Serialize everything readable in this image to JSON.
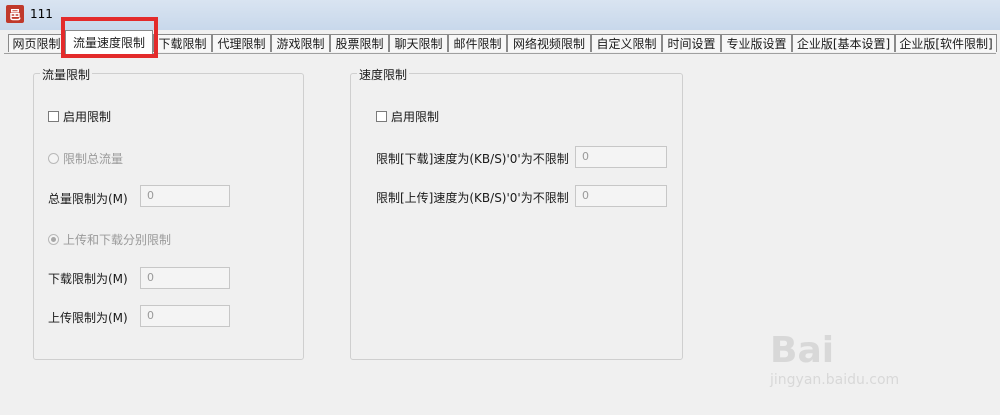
{
  "window": {
    "title": "111"
  },
  "tabs": [
    "网页限制",
    "流量速度限制",
    "下载限制",
    "代理限制",
    "游戏限制",
    "股票限制",
    "聊天限制",
    "邮件限制",
    "网络视频限制",
    "自定义限制",
    "时间设置",
    "专业版设置",
    "企业版[基本设置]",
    "企业版[软件限制]"
  ],
  "active_tab": "流量速度限制",
  "traffic": {
    "title": "流量限制",
    "enable_label": "启用限制",
    "total_radio_label": "限制总流量",
    "total_label": "总量限制为(M)",
    "total_value": "0",
    "split_radio_label": "上传和下载分别限制",
    "download_label": "下载限制为(M)",
    "download_value": "0",
    "upload_label": "上传限制为(M)",
    "upload_value": "0"
  },
  "speed": {
    "title": "速度限制",
    "enable_label": "启用限制",
    "download_label": "限制[下载]速度为(KB/S)'0'为不限制",
    "download_value": "0",
    "upload_label": "限制[上传]速度为(KB/S)'0'为不限制",
    "upload_value": "0"
  },
  "watermark": {
    "main": "Bai",
    "sub": "jingyan.baidu.com"
  },
  "colors": {
    "highlight": "#e32b2b",
    "titlebar": "#d9e4f1"
  }
}
